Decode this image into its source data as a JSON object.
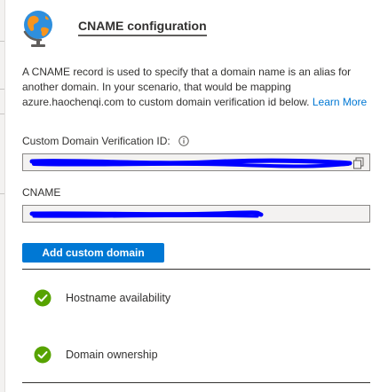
{
  "header": {
    "title": "CNAME configuration",
    "icon": "globe-icon"
  },
  "description": {
    "text": "A CNAME record is used to specify that a domain name is an alias for another domain. In your scenario, that would be mapping azure.haochenqi.com to custom domain verification id below.",
    "link_label": "Learn More"
  },
  "verification": {
    "label": "Custom Domain Verification ID:",
    "info_icon": "info-icon",
    "value": "",
    "copy_icon": "copy-icon"
  },
  "cname": {
    "label": "CNAME",
    "value": ""
  },
  "actions": {
    "add_label": "Add custom domain"
  },
  "checks": [
    {
      "label": "Hostname availability",
      "status": "success"
    },
    {
      "label": "Domain ownership",
      "status": "success"
    }
  ],
  "colors": {
    "accent": "#0078d4",
    "success": "#57a300",
    "redaction": "#0000ff"
  }
}
